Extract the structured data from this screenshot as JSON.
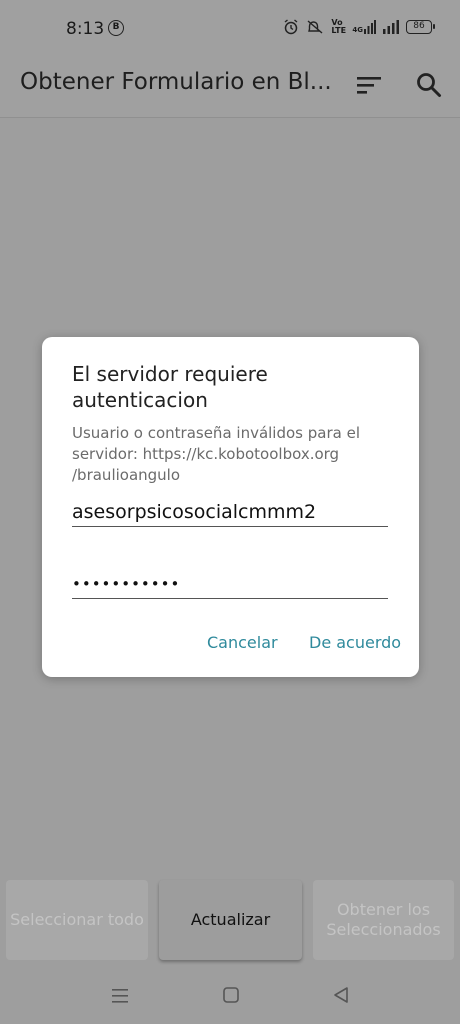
{
  "status_bar": {
    "time": "8:13",
    "b_badge": "B",
    "icons": [
      "alarm-icon",
      "mute-icon",
      "volte-icon",
      "4g-signal-icon",
      "signal-icon"
    ],
    "network_label": "Vo LTE",
    "data_label": "4G",
    "battery": "86"
  },
  "app_bar": {
    "title": "Obtener Formulario en Bl...",
    "sort_icon": "sort-icon",
    "search_icon": "search-icon"
  },
  "dialog": {
    "title": "El servidor requiere autenticacion",
    "message": "Usuario o contraseña inválidos para el servidor: https://kc.kobotoolbox.org /braulioangulo",
    "username_value": "asesorpsicosocialcmmm2",
    "password_value": "•••••••••••",
    "cancel_label": "Cancelar",
    "ok_label": "De acuerdo",
    "accent_color": "#2f8a9c"
  },
  "bottom_buttons": {
    "select_all": "Seleccionar todo",
    "refresh": "Actualizar",
    "get_selected": "Obtener los Seleccionados"
  },
  "nav_bar": {
    "icons": [
      "menu-icon",
      "home-icon",
      "back-icon"
    ]
  }
}
